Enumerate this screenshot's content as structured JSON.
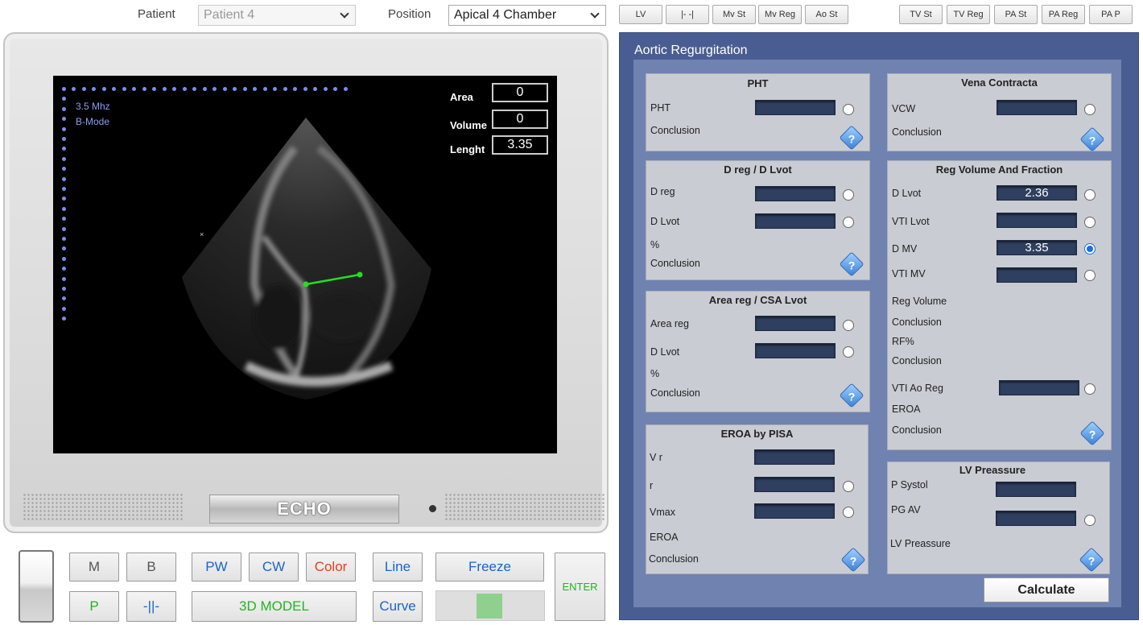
{
  "header": {
    "patient_label": "Patient",
    "patient_value": "Patient 4",
    "position_label": "Position",
    "position_value": "Apical 4 Chamber",
    "mode_buttons_left": [
      "LV",
      "|- -|",
      "Mv St",
      "Mv Reg",
      "Ao St"
    ],
    "mode_buttons_right": [
      "TV St",
      "TV Reg",
      "PA St",
      "PA Reg",
      "PA P"
    ]
  },
  "screen": {
    "frequency": "3.5 Mhz",
    "mode": "B-Mode",
    "area_label": "Area",
    "area_value": "0",
    "volume_label": "Volume",
    "volume_value": "0",
    "length_label": "Lenght",
    "length_value": "3.35",
    "brand": "ECHO"
  },
  "controls": {
    "m": "M",
    "b": "B",
    "pw": "PW",
    "cw": "CW",
    "color": "Color",
    "line": "Line",
    "freeze": "Freeze",
    "enter": "ENTER",
    "p": "P",
    "split": "-||-",
    "model3d": "3D MODEL",
    "curve": "Curve",
    "colors": {
      "blue": "#1a64c8",
      "green": "#22b422",
      "red": "#e8401c"
    }
  },
  "panel": {
    "title": "Aortic Regurgitation",
    "pht": {
      "title": "PHT",
      "pht": "PHT",
      "conclusion": "Conclusion"
    },
    "dreg": {
      "title": "D reg / D Lvot",
      "dreg": "D reg",
      "dlvot": "D Lvot",
      "pct": "%",
      "conclusion": "Conclusion"
    },
    "area": {
      "title": "Area reg / CSA Lvot",
      "areareg": "Area reg",
      "dlvot": "D Lvot",
      "pct": "%",
      "conclusion": "Conclusion"
    },
    "eroa": {
      "title": "EROA by PISA",
      "vr": "V r",
      "r": "r",
      "vmax": "Vmax",
      "eroa": "EROA",
      "conclusion": "Conclusion"
    },
    "vena": {
      "title": "Vena Contracta",
      "vcw": "VCW",
      "conclusion": "Conclusion"
    },
    "regvol": {
      "title": "Reg Volume And Fraction",
      "dlvot": "D Lvot",
      "dlvot_value": "2.36",
      "vtilvot": "VTI Lvot",
      "dmv": "D MV",
      "dmv_value": "3.35",
      "vtimv": "VTI MV",
      "regvolume": "Reg Volume",
      "conclusion1": "Conclusion",
      "rf": "RF%",
      "conclusion2": "Conclusion",
      "vtiaoreg": "VTI Ao Reg",
      "eroa": "EROA",
      "conclusion3": "Conclusion"
    },
    "lvp": {
      "title": "LV Preassure",
      "psystol": "P Systol",
      "pgav": "PG AV",
      "lvp": "LV Preassure"
    },
    "help_glyph": "?",
    "calculate": "Calculate"
  }
}
